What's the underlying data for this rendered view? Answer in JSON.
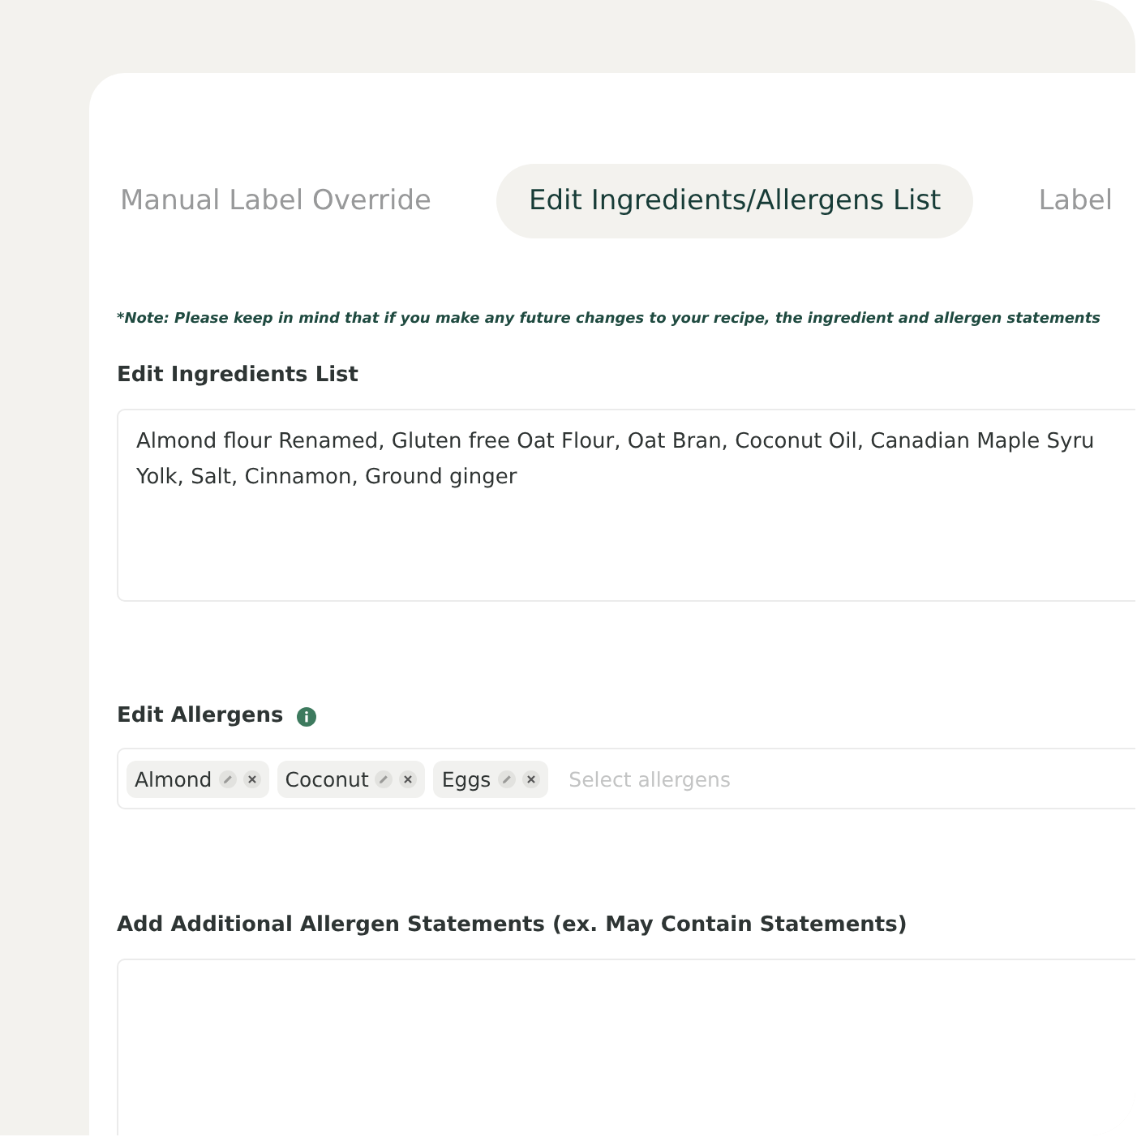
{
  "tabs": [
    {
      "label": "Manual Label Override",
      "selected": false
    },
    {
      "label": "Edit Ingredients/Allergens List",
      "selected": true
    },
    {
      "label": "Label",
      "selected": false
    }
  ],
  "note": "*Note: Please keep in mind that if you make any future changes to your recipe, the ingredient and allergen statements",
  "ingredients": {
    "label": "Edit Ingredients List",
    "lines": [
      "Almond flour Renamed, Gluten free Oat Flour, Oat Bran, Coconut Oil, Canadian Maple Syru",
      "Yolk, Salt, Cinnamon, Ground ginger"
    ]
  },
  "allergens": {
    "label": "Edit Allergens",
    "tags": [
      "Almond",
      "Coconut",
      "Eggs"
    ],
    "placeholder": "Select allergens"
  },
  "additional": {
    "label": "Add Additional Allergen Statements (ex. May Contain Statements)"
  }
}
